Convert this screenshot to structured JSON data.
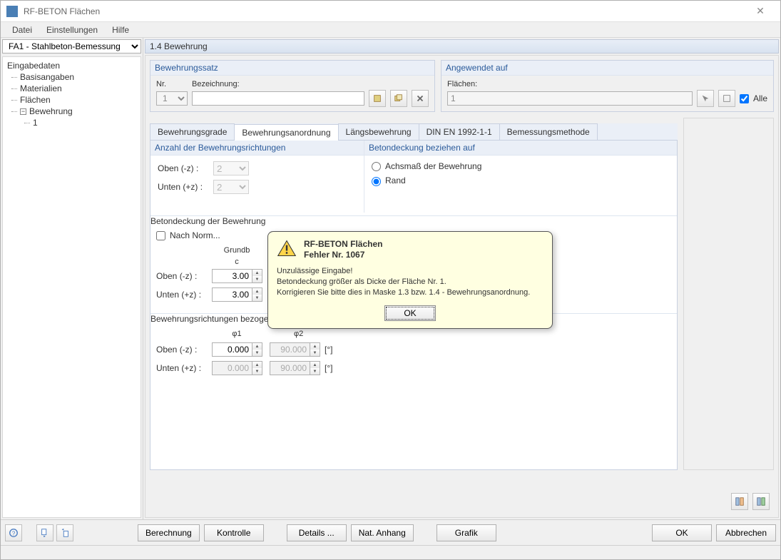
{
  "window": {
    "title": "RF-BETON Flächen"
  },
  "menu": {
    "file": "Datei",
    "settings": "Einstellungen",
    "help": "Hilfe"
  },
  "sidebar": {
    "case": "FA1 - Stahlbeton-Bemessung",
    "root": "Eingabedaten",
    "items": [
      "Basisangaben",
      "Materialien",
      "Flächen",
      "Bewehrung"
    ],
    "bewehrung_child": "1"
  },
  "header": {
    "section": "1.4 Bewehrung"
  },
  "bewehrungssatz": {
    "title": "Bewehrungssatz",
    "nr_label": "Nr.",
    "nr_value": "1",
    "bez_label": "Bezeichnung:",
    "bez_value": ""
  },
  "angewendet": {
    "title": "Angewendet auf",
    "flaechen_label": "Flächen:",
    "flaechen_value": "1",
    "alle": "Alle"
  },
  "tabs": [
    "Bewehrungsgrade",
    "Bewehrungsanordnung",
    "Längsbewehrung",
    "DIN EN 1992-1-1",
    "Bemessungsmethode"
  ],
  "active_tab_index": 1,
  "anzahl": {
    "title": "Anzahl der Bewehrungsrichtungen",
    "oben": "Oben (-z) :",
    "oben_val": "2",
    "unten": "Unten (+z) :",
    "unten_val": "2"
  },
  "betondeckung_auf": {
    "title": "Betondeckung beziehen auf",
    "opt1": "Achsmaß der Bewehrung",
    "opt2": "Rand",
    "selected": "opt2"
  },
  "betondeckung_bew": {
    "title": "Betondeckung der Bewehrung",
    "nachnorm": "Nach Norm...",
    "col1": "Grundb",
    "col1sub": "c",
    "oben": "Oben (-z) :",
    "oben_val": "3.00",
    "unten": "Unten (+z) :",
    "unten_val": "3.00"
  },
  "richtungen": {
    "title": "Bewehrungsrichtungen bezogen auf lokale Achse x des FE-Elementes für Ergebnisse",
    "phi1": "φ1",
    "phi2": "φ2",
    "oben": "Oben (-z) :",
    "oben_p1": "0.000",
    "oben_p2": "90.000",
    "unten": "Unten (+z) :",
    "unten_p1": "0.000",
    "unten_p2": "90.000",
    "unit": "[°]"
  },
  "modal": {
    "title1": "RF-BETON Flächen",
    "title2": "Fehler Nr. 1067",
    "line1": "Unzulässige Eingabe!",
    "line2": "Betondeckung größer als Dicke der Fläche Nr. 1.",
    "line3": "Korrigieren Sie bitte dies in Maske 1.3 bzw. 1.4 - Bewehrungsanordnung.",
    "ok": "OK"
  },
  "footer": {
    "berechnung": "Berechnung",
    "kontrolle": "Kontrolle",
    "details": "Details ...",
    "anhang": "Nat. Anhang",
    "grafik": "Grafik",
    "ok": "OK",
    "abbrechen": "Abbrechen"
  }
}
